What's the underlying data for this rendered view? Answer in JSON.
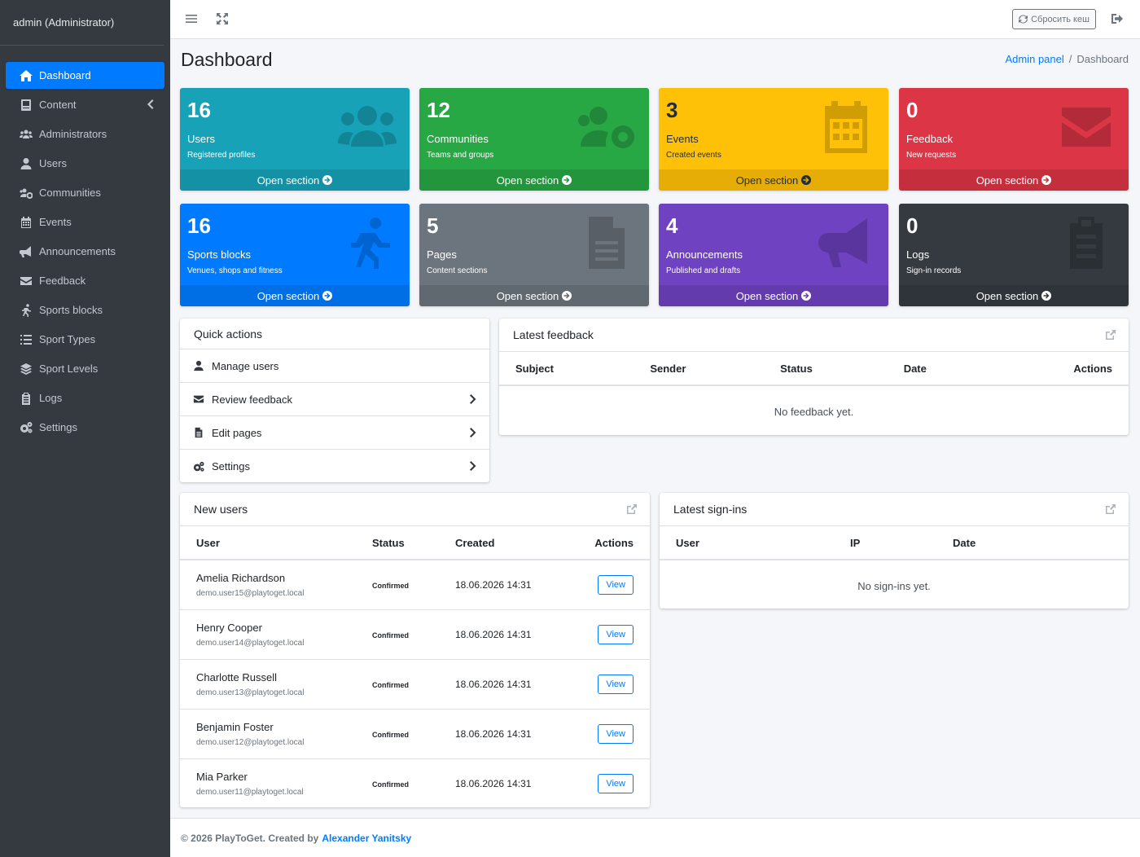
{
  "sidebar": {
    "user": "admin (Administrator)",
    "items": [
      {
        "label": "Dashboard",
        "icon": "home-icon",
        "active": true
      },
      {
        "label": "Content",
        "icon": "content-icon"
      },
      {
        "label": "Administrators",
        "icon": "users-group-icon"
      },
      {
        "label": "Users",
        "icon": "user-icon"
      },
      {
        "label": "Communities",
        "icon": "users-cog-icon"
      },
      {
        "label": "Events",
        "icon": "calendar-icon"
      },
      {
        "label": "Announcements",
        "icon": "megaphone-icon"
      },
      {
        "label": "Feedback",
        "icon": "envelope-icon"
      },
      {
        "label": "Sports blocks",
        "icon": "running-icon"
      },
      {
        "label": "Sport Types",
        "icon": "list-icon"
      },
      {
        "label": "Sport Levels",
        "icon": "layers-icon"
      },
      {
        "label": "Logs",
        "icon": "clipboard-icon"
      },
      {
        "label": "Settings",
        "icon": "cogs-icon"
      }
    ]
  },
  "topbar": {
    "cache_button": "Сбросить кеш"
  },
  "header": {
    "title": "Dashboard",
    "breadcrumb_link": "Admin panel",
    "breadcrumb_sep": "/",
    "breadcrumb_current": "Dashboard"
  },
  "boxes": [
    {
      "value": "16",
      "label": "Users",
      "sub": "Registered profiles",
      "footer": "Open section",
      "color": "#17a2b8"
    },
    {
      "value": "12",
      "label": "Communities",
      "sub": "Teams and groups",
      "footer": "Open section",
      "color": "#28a745"
    },
    {
      "value": "3",
      "label": "Events",
      "sub": "Created events",
      "footer": "Open section",
      "color": "#ffc107"
    },
    {
      "value": "0",
      "label": "Feedback",
      "sub": "New requests",
      "footer": "Open section",
      "color": "#dc3545"
    },
    {
      "value": "16",
      "label": "Sports blocks",
      "sub": "Venues, shops and fitness",
      "footer": "Open section",
      "color": "#007bff"
    },
    {
      "value": "5",
      "label": "Pages",
      "sub": "Content sections",
      "footer": "Open section",
      "color": "#6c757d"
    },
    {
      "value": "4",
      "label": "Announcements",
      "sub": "Published and drafts",
      "footer": "Open section",
      "color": "#6f42c1"
    },
    {
      "value": "0",
      "label": "Logs",
      "sub": "Sign-in records",
      "footer": "Open section",
      "color": "#343a40"
    }
  ],
  "quick_actions": {
    "title": "Quick actions",
    "items": [
      "Manage users",
      "Review feedback",
      "Edit pages",
      "Settings"
    ]
  },
  "latest_feedback": {
    "title": "Latest feedback",
    "columns": [
      "Subject",
      "Sender",
      "Status",
      "Date",
      "Actions"
    ],
    "empty": "No feedback yet."
  },
  "new_users": {
    "title": "New users",
    "columns": [
      "User",
      "Status",
      "Created",
      "Actions"
    ],
    "rows": [
      {
        "name": "Amelia Richardson",
        "email": "demo.user15@playtoget.local",
        "status": "Confirmed",
        "created": "18.06.2026 14:31",
        "action": "View"
      },
      {
        "name": "Henry Cooper",
        "email": "demo.user14@playtoget.local",
        "status": "Confirmed",
        "created": "18.06.2026 14:31",
        "action": "View"
      },
      {
        "name": "Charlotte Russell",
        "email": "demo.user13@playtoget.local",
        "status": "Confirmed",
        "created": "18.06.2026 14:31",
        "action": "View"
      },
      {
        "name": "Benjamin Foster",
        "email": "demo.user12@playtoget.local",
        "status": "Confirmed",
        "created": "18.06.2026 14:31",
        "action": "View"
      },
      {
        "name": "Mia Parker",
        "email": "demo.user11@playtoget.local",
        "status": "Confirmed",
        "created": "18.06.2026 14:31",
        "action": "View"
      }
    ]
  },
  "latest_signins": {
    "title": "Latest sign-ins",
    "columns": [
      "User",
      "IP",
      "Date"
    ],
    "empty": "No sign-ins yet."
  },
  "footer": {
    "text": "© 2026 PlayToGet. Created by",
    "author": "Alexander Yanitsky"
  }
}
